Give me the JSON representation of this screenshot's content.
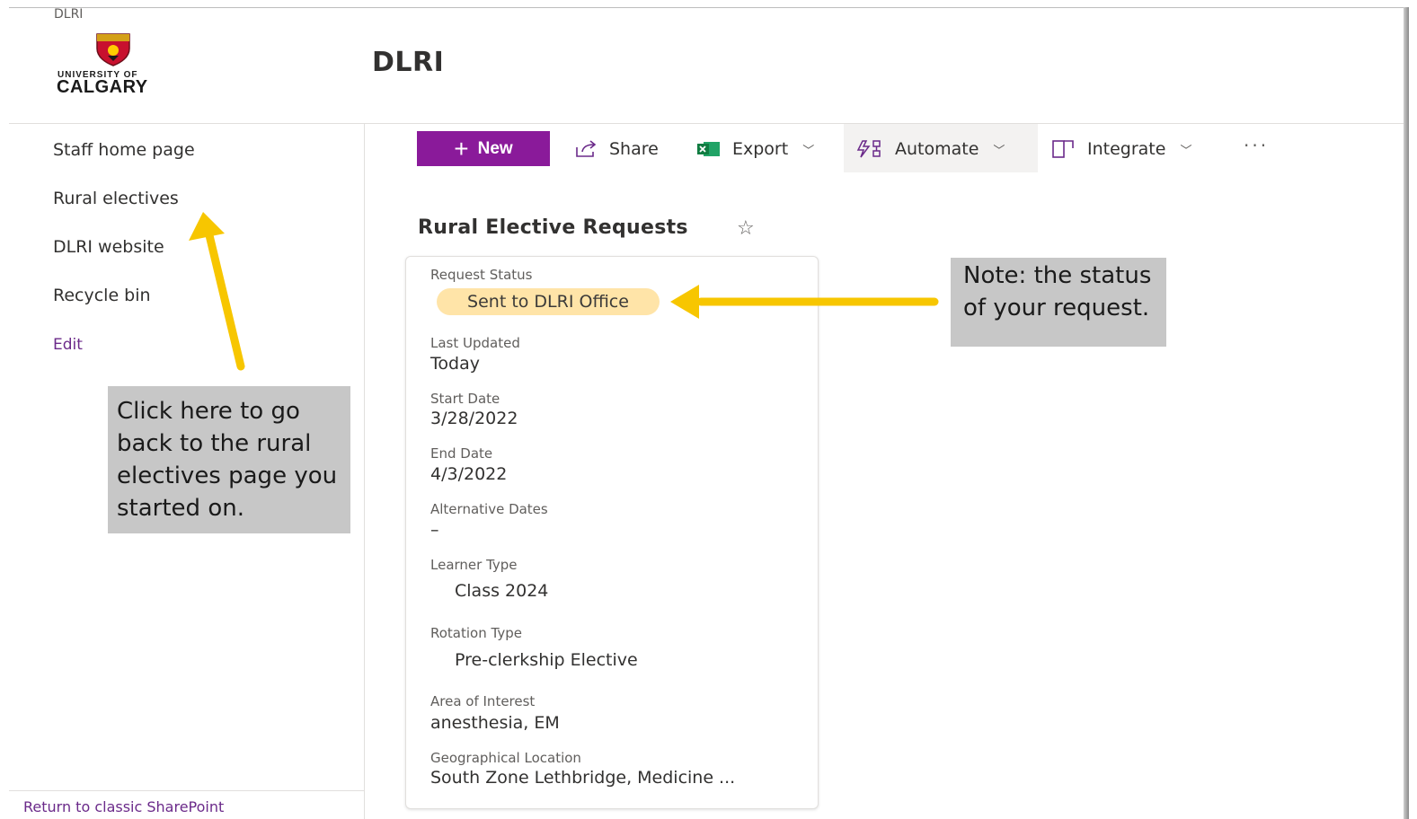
{
  "header": {
    "site_small": "DLRI",
    "logo_line1": "UNIVERSITY OF",
    "logo_line2": "CALGARY",
    "site_title": "DLRI"
  },
  "nav": {
    "items": [
      {
        "label": "Staff home page"
      },
      {
        "label": "Rural electives"
      },
      {
        "label": "DLRI website"
      },
      {
        "label": "Recycle bin"
      },
      {
        "label": "Edit"
      }
    ],
    "classic_link": "Return to classic SharePoint"
  },
  "commands": {
    "new": "New",
    "share": "Share",
    "export": "Export",
    "automate": "Automate",
    "integrate": "Integrate",
    "more": "···"
  },
  "list": {
    "title": "Rural Elective Requests"
  },
  "card": {
    "request_status": {
      "label": "Request Status",
      "value": "Sent to DLRI Office"
    },
    "last_updated": {
      "label": "Last Updated",
      "value": "Today"
    },
    "start_date": {
      "label": "Start Date",
      "value": "3/28/2022"
    },
    "end_date": {
      "label": "End Date",
      "value": "4/3/2022"
    },
    "alternative_dates": {
      "label": "Alternative Dates",
      "value": "–"
    },
    "learner_type": {
      "label": "Learner Type",
      "value": "Class 2024"
    },
    "rotation_type": {
      "label": "Rotation Type",
      "value": "Pre-clerkship Elective"
    },
    "area_of_interest": {
      "label": "Area of Interest",
      "value": "anesthesia, EM"
    },
    "geographical_location": {
      "label": "Geographical Location",
      "value": "South Zone Lethbridge, Medicine ..."
    }
  },
  "annotations": {
    "left_callout": "Click here to go back to the rural electives page you started on.",
    "right_callout": "Note: the status of your request."
  },
  "colors": {
    "brand_purple": "#8a1a9a",
    "status_pill": "#ffe4a8",
    "arrow_yellow": "#f7c600",
    "callout_gray": "#c7c7c7"
  }
}
